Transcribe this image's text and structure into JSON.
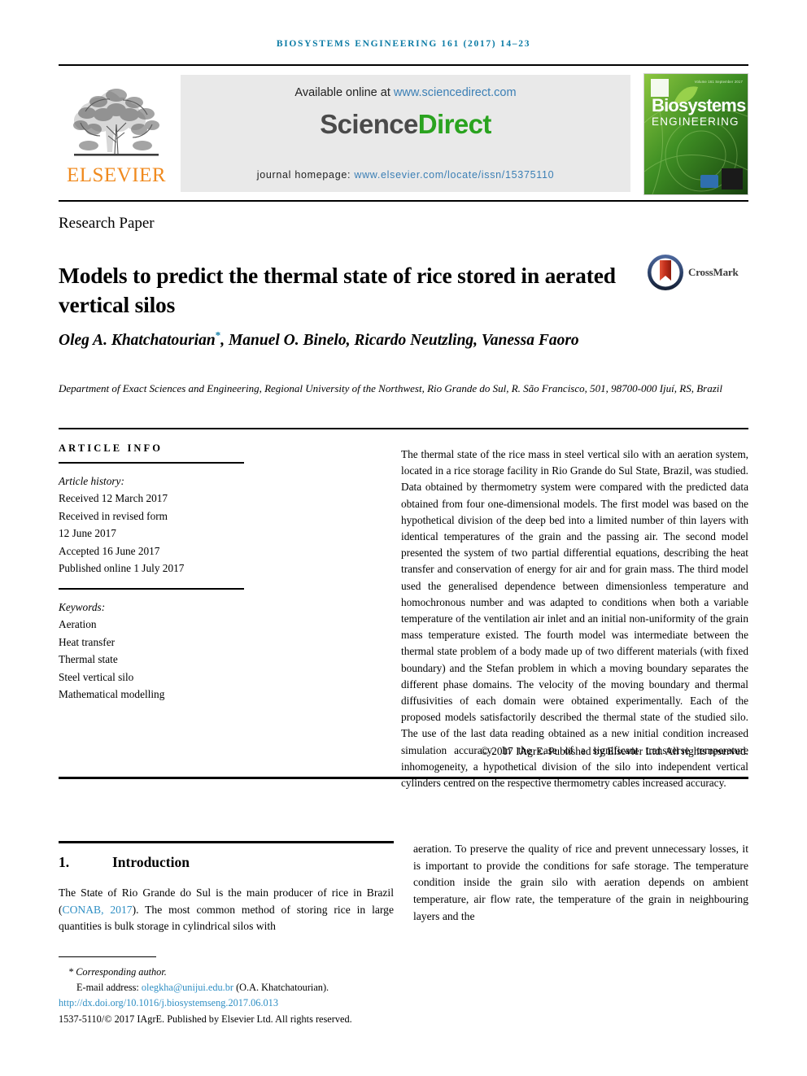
{
  "running_head": "Biosystems Engineering 161 (2017) 14–23",
  "masthead": {
    "elsevier_wordmark": "ELSEVIER",
    "available_prefix": "Available online at ",
    "available_link": "www.sciencedirect.com",
    "sciencedirect_part1": "Science",
    "sciencedirect_part2": "Direct",
    "homepage_label": "journal homepage: ",
    "homepage_link": "www.elsevier.com/locate/issn/15375110",
    "cover": {
      "issue_line": "Volume 161  September 2017",
      "title_line1": "Biosystems",
      "title_line2": "ENGINEERING"
    }
  },
  "article": {
    "type": "Research Paper",
    "title": "Models to predict the thermal state of rice stored in aerated vertical silos",
    "crossmark_label": "CrossMark",
    "authors": "Oleg A. Khatchatourian, Manuel O. Binelo, Ricardo Neutzling, Vanessa Faoro",
    "author_marker": "*",
    "affiliation": "Department of Exact Sciences and Engineering, Regional University of the Northwest, Rio Grande do Sul, R. São Francisco, 501, 98700-000 Ijuí, RS, Brazil"
  },
  "info": {
    "heading": "ARTICLE INFO",
    "history_label": "Article history:",
    "history": [
      "Received 12 March 2017",
      "Received in revised form",
      "12 June 2017",
      "Accepted 16 June 2017",
      "Published online 1 July 2017"
    ],
    "keywords_label": "Keywords:",
    "keywords": [
      "Aeration",
      "Heat transfer",
      "Thermal state",
      "Steel vertical silo",
      "Mathematical modelling"
    ]
  },
  "abstract": {
    "text": "The thermal state of the rice mass in steel vertical silo with an aeration system, located in a rice storage facility in Rio Grande do Sul State, Brazil, was studied. Data obtained by thermometry system were compared with the predicted data obtained from four one-dimensional models. The first model was based on the hypothetical division of the deep bed into a limited number of thin layers with identical temperatures of the grain and the passing air. The second model presented the system of two partial differential equations, describing the heat transfer and conservation of energy for air and for grain mass. The third model used the generalised dependence between dimensionless temperature and homochronous number and was adapted to conditions when both a variable temperature of the ventilation air inlet and an initial non-uniformity of the grain mass temperature existed. The fourth model was intermediate between the thermal state problem of a body made up of two different materials (with fixed boundary) and the Stefan problem in which a moving boundary separates the different phase domains. The velocity of the moving boundary and thermal diffusivities of each domain were obtained experimentally. Each of the proposed models satisfactorily described the thermal state of the studied silo. The use of the last data reading obtained as a new initial condition increased simulation accuracy. In the case of a significant transverse temperature inhomogeneity, a hypothetical division of the silo into independent vertical cylinders centred on the respective thermometry cables increased accuracy.",
    "copyright": "© 2017 IAgrE. Published by Elsevier Ltd. All rights reserved."
  },
  "body": {
    "section_number": "1.",
    "section_title": "Introduction",
    "left_paragraph_part1": "The State of Rio Grande do Sul is the main producer of rice in Brazil (",
    "left_citation": "CONAB, 2017",
    "left_paragraph_part2": "). The most common method of storing rice in large quantities is bulk storage in cylindrical silos with",
    "right_paragraph": "aeration. To preserve the quality of rice and prevent unnecessary losses, it is important to provide the conditions for safe storage. The temperature condition inside the grain silo with aeration depends on ambient temperature, air flow rate, the temperature of the grain in neighbouring layers and the"
  },
  "footnotes": {
    "corresponding": "* Corresponding author.",
    "email_label": "E-mail address: ",
    "email": "olegkha@unijui.edu.br",
    "email_owner": " (O.A. Khatchatourian).",
    "doi": "http://dx.doi.org/10.1016/j.biosystemseng.2017.06.013",
    "issn_line": "1537-5110/© 2017 IAgrE. Published by Elsevier Ltd. All rights reserved."
  },
  "colors": {
    "running_head": "#0b7ba5",
    "link_blue": "#2f8fc4",
    "elsevier_orange": "#F08A1E",
    "sciencedirect_green": "#2aa31f",
    "cover_green": "#2f7d1f",
    "crossmark_red": "#c4301c",
    "crossmark_navy": "#2a3f66"
  }
}
